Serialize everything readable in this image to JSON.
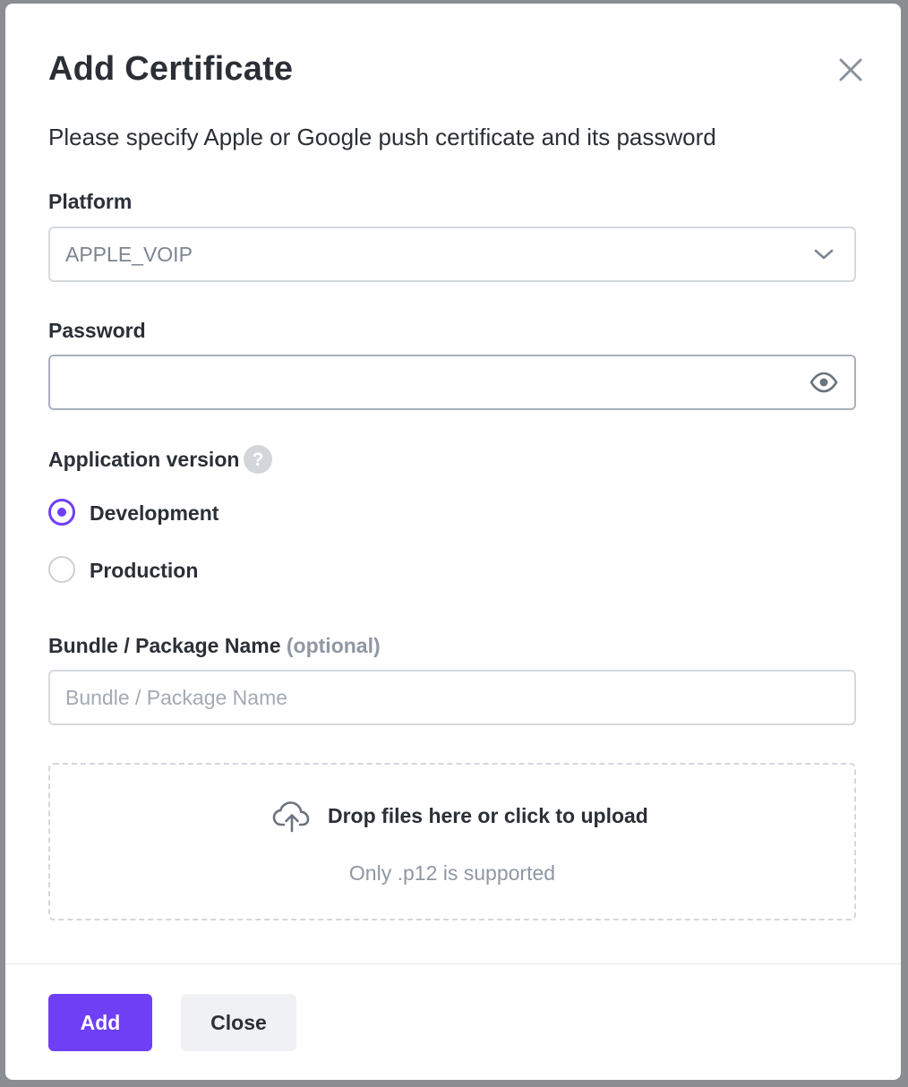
{
  "dialog": {
    "title": "Add Certificate",
    "subtitle": "Please specify Apple or Google push certificate and its password"
  },
  "platform": {
    "label": "Platform",
    "selected": "APPLE_VOIP"
  },
  "password": {
    "label": "Password",
    "value": ""
  },
  "app_version": {
    "label": "Application version",
    "options": [
      {
        "label": "Development",
        "checked": true
      },
      {
        "label": "Production",
        "checked": false
      }
    ]
  },
  "bundle": {
    "label": "Bundle / Package Name",
    "optional": "(optional)",
    "placeholder": "Bundle / Package Name",
    "value": ""
  },
  "upload": {
    "text": "Drop files here or click to upload",
    "hint": "Only .p12 is supported"
  },
  "buttons": {
    "add": "Add",
    "close": "Close"
  },
  "colors": {
    "accent": "#6f3ff5",
    "overlay": "#8a8d92"
  },
  "icons": {
    "close": "close-icon",
    "dropdown": "chevron-down-icon",
    "password_toggle": "eye-icon",
    "help": "question-circle-icon",
    "upload": "cloud-upload-icon"
  }
}
